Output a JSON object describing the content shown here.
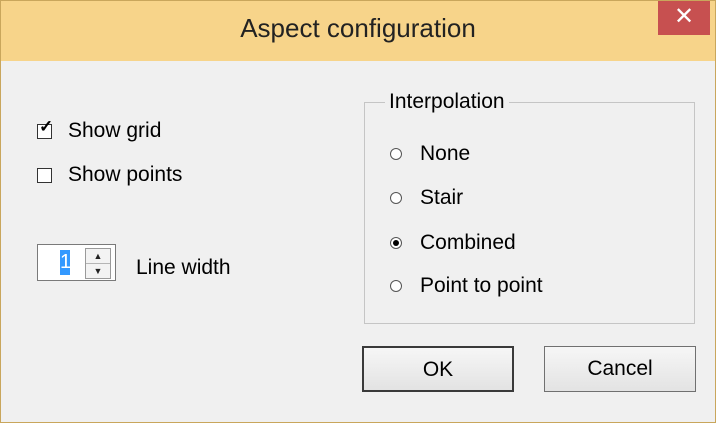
{
  "window": {
    "title": "Aspect configuration",
    "close_label": "✕"
  },
  "options": {
    "show_grid": {
      "label": "Show grid",
      "checked": true
    },
    "show_points": {
      "label": "Show points",
      "checked": false
    }
  },
  "line_width": {
    "value": "1",
    "label": "Line width"
  },
  "interpolation": {
    "legend": "Interpolation",
    "options": [
      {
        "label": "None",
        "selected": false
      },
      {
        "label": "Stair",
        "selected": false
      },
      {
        "label": "Combined",
        "selected": true
      },
      {
        "label": "Point to point",
        "selected": false
      }
    ]
  },
  "buttons": {
    "ok": "OK",
    "cancel": "Cancel"
  }
}
